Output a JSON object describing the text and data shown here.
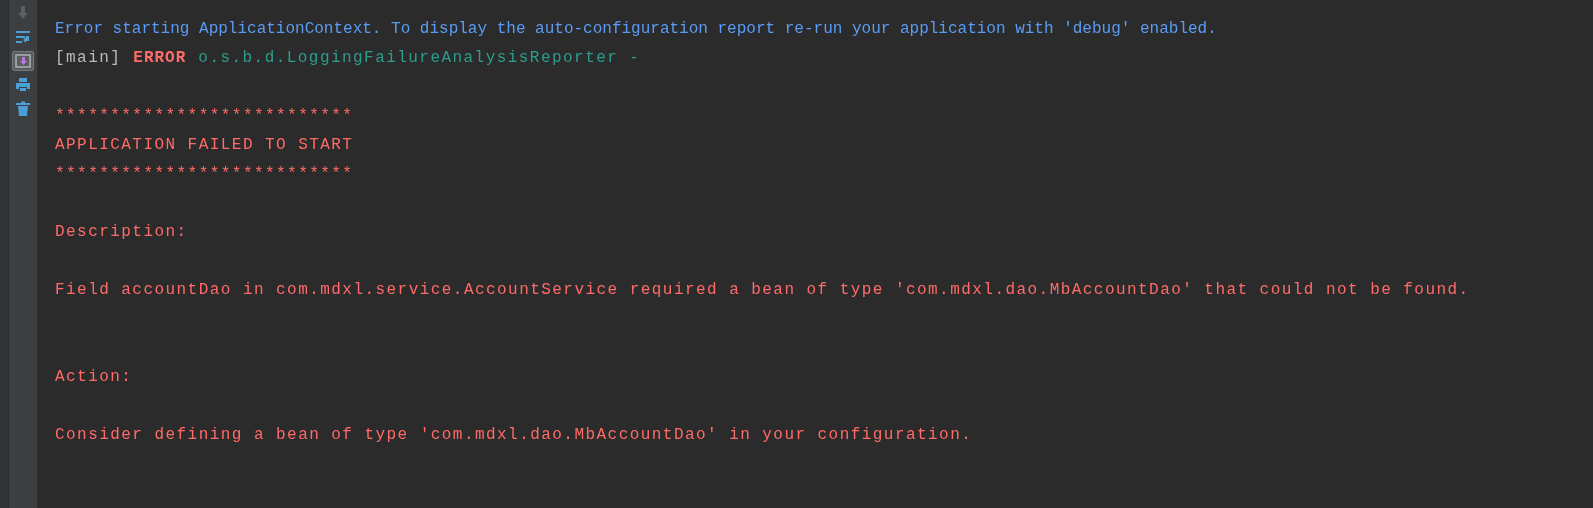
{
  "toolbar": [
    {
      "kind": "down",
      "disabled": true,
      "selected": false
    },
    {
      "kind": "wrap",
      "disabled": false,
      "selected": false
    },
    {
      "kind": "scroll",
      "disabled": false,
      "selected": true
    },
    {
      "kind": "print",
      "disabled": false,
      "selected": false
    },
    {
      "kind": "trash",
      "disabled": false,
      "selected": false
    }
  ],
  "console": {
    "blocks": [
      {
        "kind": "log",
        "lines": [
          [
            {
              "kind": "info",
              "text": "Error starting ApplicationContext. To display the auto-configuration report re-run your application with 'debug' enabled."
            }
          ],
          [
            {
              "kind": "plain",
              "text": "[main]"
            },
            {
              "kind": "level",
              "text": "ERROR"
            },
            {
              "kind": "logger",
              "text": "o.s.b.d.LoggingFailureAnalysisReporter -"
            }
          ]
        ]
      },
      {
        "kind": "banner",
        "lines": [
          [
            {
              "kind": "error",
              "text": "***************************"
            }
          ],
          [
            {
              "kind": "error",
              "text": "APPLICATION FAILED TO START"
            }
          ],
          [
            {
              "kind": "error",
              "text": "***************************"
            }
          ]
        ]
      },
      {
        "kind": "heading",
        "lines": [
          [
            {
              "kind": "error",
              "text": "Description:"
            }
          ]
        ]
      },
      {
        "kind": "detail",
        "lines": [
          [
            {
              "kind": "error",
              "text": "Field accountDao in com.mdxl.service.AccountService required a bean of type 'com.mdxl.dao.MbAccountDao' that could not be found."
            }
          ]
        ]
      },
      {
        "kind": "heading",
        "lines": [
          [
            {
              "kind": "error",
              "text": "Action:"
            }
          ]
        ]
      },
      {
        "kind": "detail",
        "lines": [
          [
            {
              "kind": "error",
              "text": "Consider defining a bean of type 'com.mdxl.dao.MbAccountDao' in your configuration."
            }
          ]
        ]
      }
    ]
  }
}
